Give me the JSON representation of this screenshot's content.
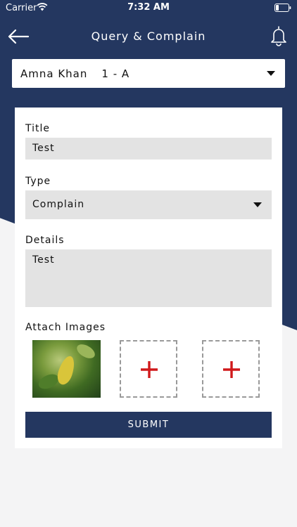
{
  "colors": {
    "primary": "#243760",
    "background": "#f4f4f5",
    "field": "#e3e3e3",
    "accent_plus": "#d0191b"
  },
  "status_bar": {
    "carrier": "Carrier",
    "time": "7:32 AM",
    "wifi_icon": "wifi-icon",
    "battery_icon": "battery-icon"
  },
  "header": {
    "title": "Query & Complain",
    "back_icon": "arrow-left-icon",
    "notification_icon": "bell-icon"
  },
  "student_select": {
    "name": "Amna Khan",
    "class": "1 - A"
  },
  "form": {
    "title_label": "Title",
    "title_value": "Test",
    "type_label": "Type",
    "type_value": "Complain",
    "details_label": "Details",
    "details_value": "Test",
    "attach_label": "Attach Images",
    "attachments": [
      {
        "kind": "image"
      },
      {
        "kind": "add",
        "icon": "plus-icon"
      },
      {
        "kind": "add",
        "icon": "plus-icon"
      }
    ],
    "submit_label": "SUBMIT"
  }
}
